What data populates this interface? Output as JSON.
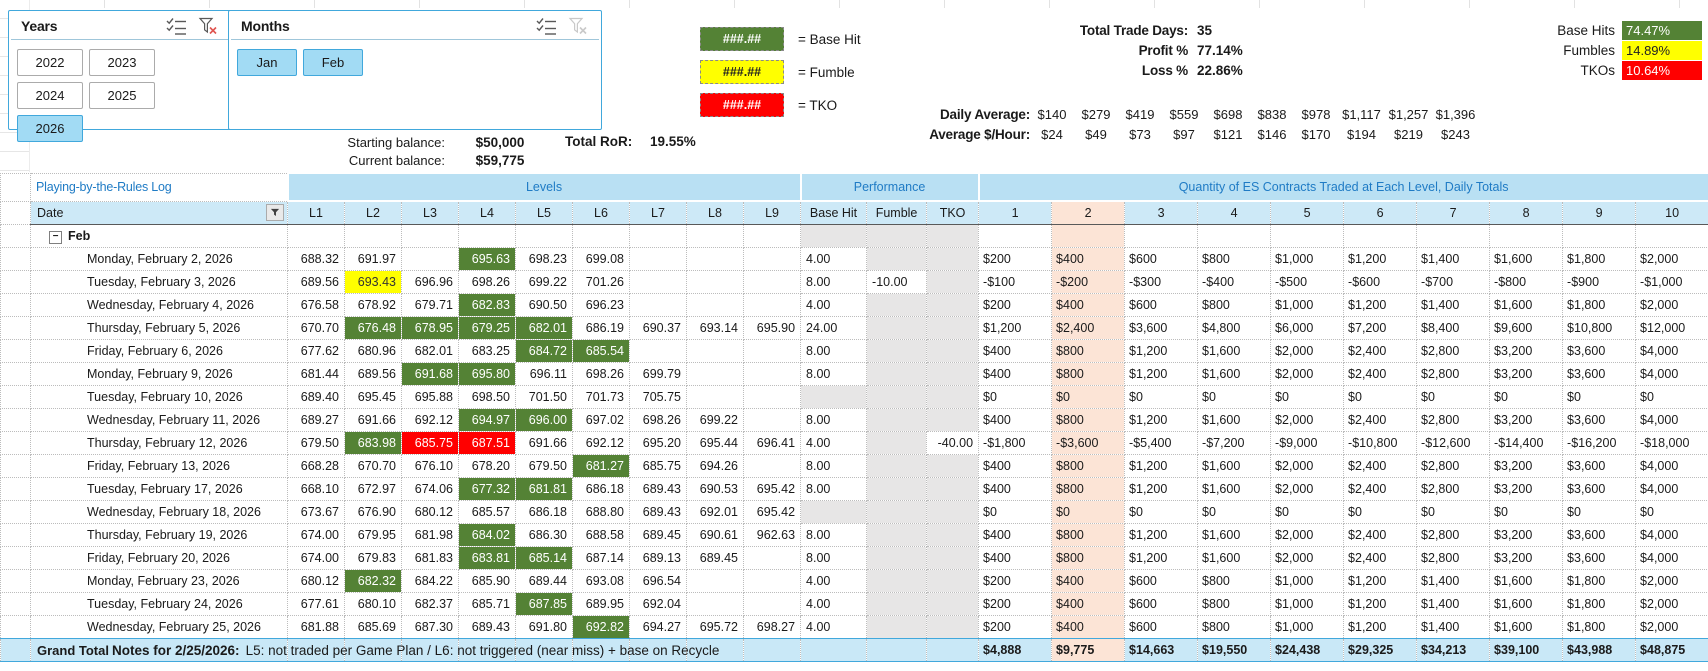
{
  "slicers": {
    "years": {
      "title": "Years",
      "buttons": [
        {
          "label": "2022",
          "selected": false
        },
        {
          "label": "2023",
          "selected": false
        },
        {
          "label": "2024",
          "selected": false
        },
        {
          "label": "2025",
          "selected": false
        },
        {
          "label": "2026",
          "selected": true
        }
      ]
    },
    "months": {
      "title": "Months",
      "buttons": [
        {
          "label": "Jan",
          "selected": true
        },
        {
          "label": "Feb",
          "selected": true
        }
      ]
    }
  },
  "legend": {
    "items": [
      {
        "code": "###.##",
        "label": "= Base Hit",
        "color": "#548235"
      },
      {
        "code": "###.##",
        "label": "= Fumble",
        "color": "#FFFF00"
      },
      {
        "code": "###.##",
        "label": "= TKO",
        "color": "#FF0000"
      }
    ]
  },
  "stats": {
    "total_trade_days_label": "Total Trade Days:",
    "total_trade_days": "35",
    "profit_label": "Profit %",
    "profit": "77.14%",
    "loss_label": "Loss %",
    "loss": "22.86%",
    "base_hits_label": "Base Hits",
    "base_hits": "74.47%",
    "fumbles_label": "Fumbles",
    "fumbles": "14.89%",
    "tkos_label": "TKOs",
    "tkos": "10.64%"
  },
  "averages": {
    "daily_label": "Daily Average:",
    "daily": [
      "$140",
      "$279",
      "$419",
      "$559",
      "$698",
      "$838",
      "$978",
      "$1,117",
      "$1,257",
      "$1,396"
    ],
    "hourly_label": "Average $/Hour:",
    "hourly": [
      "$24",
      "$49",
      "$73",
      "$97",
      "$121",
      "$146",
      "$170",
      "$194",
      "$219",
      "$243"
    ]
  },
  "balance": {
    "starting_label": "Starting balance:",
    "starting": "$50,000",
    "current_label": "Current balance:",
    "current": "$59,775",
    "ror_label": "Total RoR:",
    "ror": "19.55%"
  },
  "log": {
    "title": "Playing-by-the-Rules Log",
    "band": {
      "levels": "Levels",
      "performance": "Performance",
      "quantity": "Quantity of ES Contracts Traded at Each Level, Daily Totals"
    },
    "columns": {
      "date": "Date",
      "levels": [
        "L1",
        "L2",
        "L3",
        "L4",
        "L5",
        "L6",
        "L7",
        "L8",
        "L9"
      ],
      "performance": [
        "Base Hit",
        "Fumble",
        "TKO"
      ],
      "quantity": [
        "1",
        "2",
        "3",
        "4",
        "5",
        "6",
        "7",
        "8",
        "9",
        "10"
      ]
    },
    "group_label": "Feb",
    "rows": [
      {
        "date": "Monday, February 2, 2026",
        "levels": [
          [
            "688.32",
            "p"
          ],
          [
            "691.97",
            "b"
          ],
          [
            "",
            ""
          ],
          [
            "695.63",
            "g"
          ],
          [
            "698.23",
            "p"
          ],
          [
            "699.08",
            "p"
          ],
          [
            "",
            ""
          ],
          [
            "",
            ""
          ],
          [
            "",
            ""
          ]
        ],
        "base_hit": "4.00",
        "fumble": "",
        "tko": "",
        "qty": [
          "$200",
          "$400",
          "$600",
          "$800",
          "$1,000",
          "$1,200",
          "$1,400",
          "$1,600",
          "$1,800",
          "$2,000"
        ]
      },
      {
        "date": "Tuesday, February 3, 2026",
        "levels": [
          [
            "689.56",
            "b"
          ],
          [
            "693.43",
            "y"
          ],
          [
            "696.96",
            "p"
          ],
          [
            "698.26",
            "p"
          ],
          [
            "699.22",
            "p"
          ],
          [
            "701.26",
            "p"
          ],
          [
            "",
            ""
          ],
          [
            "",
            ""
          ],
          [
            "",
            ""
          ]
        ],
        "base_hit": "8.00",
        "fumble": "-10.00",
        "tko": "",
        "qty": [
          "-$100",
          "-$200",
          "-$300",
          "-$400",
          "-$500",
          "-$600",
          "-$700",
          "-$800",
          "-$900",
          "-$1,000"
        ]
      },
      {
        "date": "Wednesday, February 4, 2026",
        "levels": [
          [
            "676.58",
            "p"
          ],
          [
            "678.92",
            "p"
          ],
          [
            "679.71",
            "p"
          ],
          [
            "682.83",
            "g"
          ],
          [
            "690.50",
            "b"
          ],
          [
            "696.23",
            "p"
          ],
          [
            "",
            ""
          ],
          [
            "",
            ""
          ],
          [
            "",
            ""
          ]
        ],
        "base_hit": "4.00",
        "fumble": "",
        "tko": "",
        "qty": [
          "$200",
          "$400",
          "$600",
          "$800",
          "$1,000",
          "$1,200",
          "$1,400",
          "$1,600",
          "$1,800",
          "$2,000"
        ]
      },
      {
        "date": "Thursday, February 5, 2026",
        "levels": [
          [
            "670.70",
            "p"
          ],
          [
            "676.48",
            "g"
          ],
          [
            "678.95",
            "g"
          ],
          [
            "679.25",
            "g"
          ],
          [
            "682.01",
            "g"
          ],
          [
            "686.19",
            "p"
          ],
          [
            "690.37",
            "p"
          ],
          [
            "693.14",
            "p"
          ],
          [
            "695.90",
            "p"
          ]
        ],
        "base_hit": "24.00",
        "fumble": "",
        "tko": "",
        "qty": [
          "$1,200",
          "$2,400",
          "$3,600",
          "$4,800",
          "$6,000",
          "$7,200",
          "$8,400",
          "$9,600",
          "$10,800",
          "$12,000"
        ]
      },
      {
        "date": "Friday, February 6, 2026",
        "levels": [
          [
            "677.62",
            "p"
          ],
          [
            "680.96",
            "p"
          ],
          [
            "682.01",
            "p"
          ],
          [
            "683.25",
            "b"
          ],
          [
            "684.72",
            "g"
          ],
          [
            "685.54",
            "g"
          ],
          [
            "",
            ""
          ],
          [
            "",
            ""
          ],
          [
            "",
            ""
          ]
        ],
        "base_hit": "8.00",
        "fumble": "",
        "tko": "",
        "qty": [
          "$400",
          "$800",
          "$1,200",
          "$1,600",
          "$2,000",
          "$2,400",
          "$2,800",
          "$3,200",
          "$3,600",
          "$4,000"
        ]
      },
      {
        "date": "Monday, February 9, 2026",
        "levels": [
          [
            "681.44",
            "p"
          ],
          [
            "689.56",
            "p"
          ],
          [
            "691.68",
            "g"
          ],
          [
            "695.80",
            "g"
          ],
          [
            "696.11",
            "p"
          ],
          [
            "698.26",
            "p"
          ],
          [
            "699.79",
            "p"
          ],
          [
            "",
            ""
          ],
          [
            "",
            ""
          ]
        ],
        "base_hit": "8.00",
        "fumble": "",
        "tko": "",
        "qty": [
          "$400",
          "$800",
          "$1,200",
          "$1,600",
          "$2,000",
          "$2,400",
          "$2,800",
          "$3,200",
          "$3,600",
          "$4,000"
        ]
      },
      {
        "date": "Tuesday, February 10, 2026",
        "levels": [
          [
            "689.40",
            "p"
          ],
          [
            "695.45",
            "b"
          ],
          [
            "695.88",
            "b"
          ],
          [
            "698.50",
            "p"
          ],
          [
            "701.50",
            "p"
          ],
          [
            "701.73",
            "p"
          ],
          [
            "705.75",
            "p"
          ],
          [
            "",
            ""
          ],
          [
            "",
            ""
          ]
        ],
        "base_hit": "",
        "fumble": "",
        "tko": "",
        "qty": [
          "$0",
          "$0",
          "$0",
          "$0",
          "$0",
          "$0",
          "$0",
          "$0",
          "$0",
          "$0"
        ]
      },
      {
        "date": "Wednesday, February 11, 2026",
        "levels": [
          [
            "689.27",
            "b"
          ],
          [
            "691.66",
            "b"
          ],
          [
            "692.12",
            "b"
          ],
          [
            "694.97",
            "g"
          ],
          [
            "696.00",
            "g"
          ],
          [
            "697.02",
            "p"
          ],
          [
            "698.26",
            "p"
          ],
          [
            "699.22",
            "p"
          ],
          [
            "",
            ""
          ]
        ],
        "base_hit": "8.00",
        "fumble": "",
        "tko": "",
        "qty": [
          "$400",
          "$800",
          "$1,200",
          "$1,600",
          "$2,000",
          "$2,400",
          "$2,800",
          "$3,200",
          "$3,600",
          "$4,000"
        ]
      },
      {
        "date": "Thursday, February 12, 2026",
        "levels": [
          [
            "679.50",
            "p"
          ],
          [
            "683.98",
            "g"
          ],
          [
            "685.75",
            "r"
          ],
          [
            "687.51",
            "r"
          ],
          [
            "691.66",
            "p"
          ],
          [
            "692.12",
            "p"
          ],
          [
            "695.20",
            "p"
          ],
          [
            "695.44",
            "p"
          ],
          [
            "696.41",
            "p"
          ]
        ],
        "base_hit": "4.00",
        "fumble": "",
        "tko": "-40.00",
        "qty": [
          "-$1,800",
          "-$3,600",
          "-$5,400",
          "-$7,200",
          "-$9,000",
          "-$10,800",
          "-$12,600",
          "-$14,400",
          "-$16,200",
          "-$18,000"
        ]
      },
      {
        "date": "Friday, February 13, 2026",
        "levels": [
          [
            "668.28",
            "p"
          ],
          [
            "670.70",
            "p"
          ],
          [
            "676.10",
            "p"
          ],
          [
            "678.20",
            "p"
          ],
          [
            "679.50",
            "b"
          ],
          [
            "681.27",
            "g"
          ],
          [
            "685.75",
            "b"
          ],
          [
            "694.26",
            "p"
          ],
          [
            "",
            ""
          ]
        ],
        "base_hit": "8.00",
        "fumble": "",
        "tko": "",
        "qty": [
          "$400",
          "$800",
          "$1,200",
          "$1,600",
          "$2,000",
          "$2,400",
          "$2,800",
          "$3,200",
          "$3,600",
          "$4,000"
        ]
      },
      {
        "date": "Tuesday, February 17, 2026",
        "levels": [
          [
            "668.10",
            "p"
          ],
          [
            "672.97",
            "p"
          ],
          [
            "674.06",
            "p"
          ],
          [
            "677.32",
            "g"
          ],
          [
            "681.81",
            "g"
          ],
          [
            "686.18",
            "p"
          ],
          [
            "689.43",
            "p"
          ],
          [
            "690.53",
            "p"
          ],
          [
            "695.42",
            "p"
          ]
        ],
        "base_hit": "8.00",
        "fumble": "",
        "tko": "",
        "qty": [
          "$400",
          "$800",
          "$1,200",
          "$1,600",
          "$2,000",
          "$2,400",
          "$2,800",
          "$3,200",
          "$3,600",
          "$4,000"
        ]
      },
      {
        "date": "Wednesday, February 18, 2026",
        "levels": [
          [
            "673.67",
            "p"
          ],
          [
            "676.90",
            "p"
          ],
          [
            "680.12",
            "p"
          ],
          [
            "685.57",
            "b"
          ],
          [
            "686.18",
            "b"
          ],
          [
            "688.80",
            "b"
          ],
          [
            "689.43",
            "p"
          ],
          [
            "692.01",
            "p"
          ],
          [
            "695.42",
            "p"
          ]
        ],
        "base_hit": "",
        "fumble": "",
        "tko": "",
        "qty": [
          "$0",
          "$0",
          "$0",
          "$0",
          "$0",
          "$0",
          "$0",
          "$0",
          "$0",
          "$0"
        ]
      },
      {
        "date": "Thursday, February 19, 2026",
        "levels": [
          [
            "674.00",
            "p"
          ],
          [
            "679.95",
            "p"
          ],
          [
            "681.98",
            "b"
          ],
          [
            "684.02",
            "g"
          ],
          [
            "686.30",
            "p"
          ],
          [
            "688.58",
            "p"
          ],
          [
            "689.45",
            "p"
          ],
          [
            "690.61",
            "p"
          ],
          [
            "962.63",
            "p"
          ]
        ],
        "base_hit": "8.00",
        "fumble": "",
        "tko": "",
        "qty": [
          "$400",
          "$800",
          "$1,200",
          "$1,600",
          "$2,000",
          "$2,400",
          "$2,800",
          "$3,200",
          "$3,600",
          "$4,000"
        ]
      },
      {
        "date": "Friday, February 20, 2026",
        "levels": [
          [
            "674.00",
            "p"
          ],
          [
            "679.83",
            "p"
          ],
          [
            "681.83",
            "p"
          ],
          [
            "683.81",
            "g"
          ],
          [
            "685.14",
            "g"
          ],
          [
            "687.14",
            "b"
          ],
          [
            "689.13",
            "b"
          ],
          [
            "689.45",
            "b"
          ],
          [
            "",
            ""
          ]
        ],
        "base_hit": "8.00",
        "fumble": "",
        "tko": "",
        "qty": [
          "$400",
          "$800",
          "$1,200",
          "$1,600",
          "$2,000",
          "$2,400",
          "$2,800",
          "$3,200",
          "$3,600",
          "$4,000"
        ]
      },
      {
        "date": "Monday, February 23, 2026",
        "levels": [
          [
            "680.12",
            "p"
          ],
          [
            "682.32",
            "g"
          ],
          [
            "684.22",
            "b"
          ],
          [
            "685.90",
            "b"
          ],
          [
            "689.44",
            "p"
          ],
          [
            "693.08",
            "p"
          ],
          [
            "696.54",
            "p"
          ],
          [
            "",
            ""
          ],
          [
            "",
            ""
          ]
        ],
        "base_hit": "4.00",
        "fumble": "",
        "tko": "",
        "qty": [
          "$200",
          "$400",
          "$600",
          "$800",
          "$1,000",
          "$1,200",
          "$1,400",
          "$1,600",
          "$1,800",
          "$2,000"
        ]
      },
      {
        "date": "Tuesday, February 24, 2026",
        "levels": [
          [
            "677.61",
            "p"
          ],
          [
            "680.10",
            "b"
          ],
          [
            "682.37",
            "b"
          ],
          [
            "685.71",
            "b"
          ],
          [
            "687.85",
            "g"
          ],
          [
            "689.95",
            "p"
          ],
          [
            "692.04",
            "p"
          ],
          [
            "",
            ""
          ],
          [
            "",
            ""
          ]
        ],
        "base_hit": "4.00",
        "fumble": "",
        "tko": "",
        "qty": [
          "$200",
          "$400",
          "$600",
          "$800",
          "$1,000",
          "$1,200",
          "$1,400",
          "$1,600",
          "$1,800",
          "$2,000"
        ]
      },
      {
        "date": "Wednesday, February 25, 2026",
        "levels": [
          [
            "681.88",
            "p"
          ],
          [
            "685.69",
            "p"
          ],
          [
            "687.30",
            "p"
          ],
          [
            "689.43",
            "p"
          ],
          [
            "691.80",
            "b"
          ],
          [
            "692.82",
            "g"
          ],
          [
            "694.27",
            "p"
          ],
          [
            "695.72",
            "p"
          ],
          [
            "698.27",
            "p"
          ]
        ],
        "base_hit": "4.00",
        "fumble": "",
        "tko": "",
        "qty": [
          "$200",
          "$400",
          "$600",
          "$800",
          "$1,000",
          "$1,200",
          "$1,400",
          "$1,600",
          "$1,800",
          "$2,000"
        ]
      }
    ],
    "grand_total": {
      "label": "Grand Total",
      "qty": [
        "$4,888",
        "$9,775",
        "$14,663",
        "$19,550",
        "$24,438",
        "$29,325",
        "$34,213",
        "$39,100",
        "$43,988",
        "$48,875"
      ]
    },
    "notes_label": "Notes for 2/25/2026:",
    "notes": "L5: not traded per Game Plan / L6: not triggered (near miss) + base on Recycle"
  },
  "colors": {
    "accent_blue": "#1F7BC5",
    "band_blue": "#B9E0F3",
    "header_blue": "#CDE9F7",
    "grand_blue": "#C9E8F7",
    "slicer_blue": "#41A8DC",
    "selected_item": "#A2DBF4",
    "green": "#548235",
    "yellow": "#FFFF00",
    "red": "#FF0000",
    "peach": "#FCE4D6",
    "perf_gray": "#E7E6E6"
  }
}
